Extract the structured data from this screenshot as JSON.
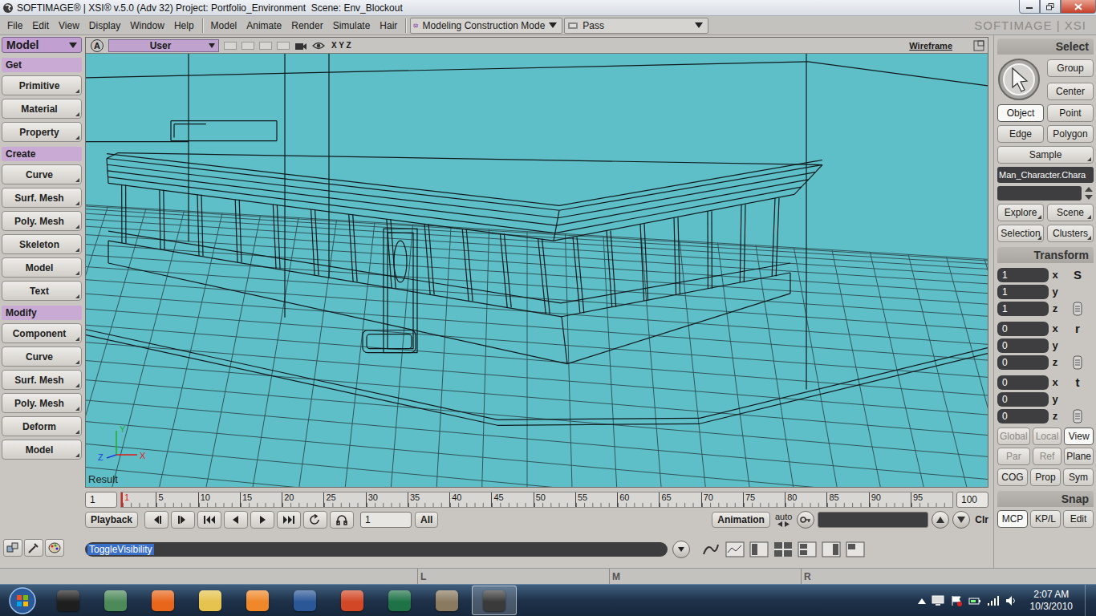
{
  "window": {
    "title": "SOFTIMAGE® | XSI® v.5.0 (Adv 32) Project: Portfolio_Environment  Scene: Env_Blockout"
  },
  "menu": {
    "items": [
      "File",
      "Edit",
      "View",
      "Display",
      "Window",
      "Help"
    ],
    "modules": [
      "Model",
      "Animate",
      "Render",
      "Simulate",
      "Hair"
    ],
    "mode": "Modeling Construction Mode",
    "pass": "Pass",
    "logo": "SOFTIMAGE | XSI"
  },
  "toolbar": {
    "module": "Model",
    "sections": [
      {
        "title": "Get",
        "items": [
          "Primitive",
          "Material",
          "Property"
        ]
      },
      {
        "title": "Create",
        "items": [
          "Curve",
          "Surf. Mesh",
          "Poly. Mesh",
          "Skeleton",
          "Model",
          "Text"
        ]
      },
      {
        "title": "Modify",
        "items": [
          "Component",
          "Curve",
          "Surf. Mesh",
          "Poly. Mesh",
          "Deform",
          "Model"
        ]
      }
    ]
  },
  "viewport": {
    "view": "A",
    "camera": "User",
    "axis_toggle": "X Y Z",
    "display_mode": "Wireframe",
    "label": "Result",
    "axes": [
      {
        "label": "Y",
        "color": "#1fae2a"
      },
      {
        "label": "X",
        "color": "#e01818"
      },
      {
        "label": "Z",
        "color": "#1c3ce0"
      }
    ]
  },
  "timeline": {
    "start": "1",
    "end": "100",
    "current": "1",
    "labels": [
      "1",
      "5",
      "10",
      "15",
      "20",
      "25",
      "30",
      "35",
      "40",
      "45",
      "50",
      "55",
      "60",
      "65",
      "70",
      "75",
      "80",
      "85",
      "90",
      "95"
    ]
  },
  "playback": {
    "button": "Playback",
    "frame": "1",
    "range": "All",
    "animation": "Animation",
    "key_mode": "auto",
    "clear": "Clr"
  },
  "command": {
    "text": "ToggleVisibility",
    "selected": true
  },
  "mouse_buttons": [
    "L",
    "M",
    "R"
  ],
  "select": {
    "title": "Select",
    "group": "Group",
    "center": "Center",
    "filters": [
      {
        "label": "Object",
        "selected": true
      },
      {
        "label": "Point",
        "selected": false
      },
      {
        "label": "Edge",
        "selected": false
      },
      {
        "label": "Polygon",
        "selected": false
      }
    ],
    "sample": "Sample",
    "name": "Man_Character.Chara",
    "nav": [
      "Explore",
      "Scene",
      "Selection",
      "Clusters"
    ]
  },
  "transform": {
    "title": "Transform",
    "groups": [
      {
        "symbol": "S",
        "rows": [
          {
            "axis": "x",
            "value": "1"
          },
          {
            "axis": "y",
            "value": "1"
          },
          {
            "axis": "z",
            "value": "1"
          }
        ]
      },
      {
        "symbol": "r",
        "rows": [
          {
            "axis": "x",
            "value": "0"
          },
          {
            "axis": "y",
            "value": "0"
          },
          {
            "axis": "z",
            "value": "0"
          }
        ]
      },
      {
        "symbol": "t",
        "rows": [
          {
            "axis": "x",
            "value": "0"
          },
          {
            "axis": "y",
            "value": "0"
          },
          {
            "axis": "z",
            "value": "0"
          }
        ]
      }
    ],
    "modes": [
      {
        "label": "Global",
        "selected": false,
        "disabled": true
      },
      {
        "label": "Local",
        "selected": false,
        "disabled": true
      },
      {
        "label": "View",
        "selected": true,
        "disabled": false
      },
      {
        "label": "Par",
        "selected": false,
        "disabled": true
      },
      {
        "label": "Ref",
        "selected": false,
        "disabled": true
      },
      {
        "label": "Plane",
        "selected": false,
        "disabled": false
      }
    ],
    "options": [
      "COG",
      "Prop",
      "Sym"
    ]
  },
  "snap": {
    "title": "Snap",
    "modes": [
      {
        "label": "MCP",
        "selected": true
      },
      {
        "label": "KP/L",
        "selected": false
      },
      {
        "label": "Edit",
        "selected": false
      }
    ]
  },
  "taskbar": {
    "apps": [
      {
        "color": "#1e1e1e",
        "selected": false
      },
      {
        "color": "#4d8a5a",
        "selected": false
      },
      {
        "color": "#e8661c",
        "selected": false
      },
      {
        "color": "#e6c24e",
        "selected": false
      },
      {
        "color": "#f0882a",
        "selected": false
      },
      {
        "color": "#2b5797",
        "selected": false
      },
      {
        "color": "#d24726",
        "selected": false
      },
      {
        "color": "#1f7246",
        "selected": false
      },
      {
        "color": "#8a7a60",
        "selected": false
      },
      {
        "color": "#3a3a3a",
        "selected": true
      }
    ],
    "time": "2:07 AM",
    "date": "10/3/2010"
  }
}
